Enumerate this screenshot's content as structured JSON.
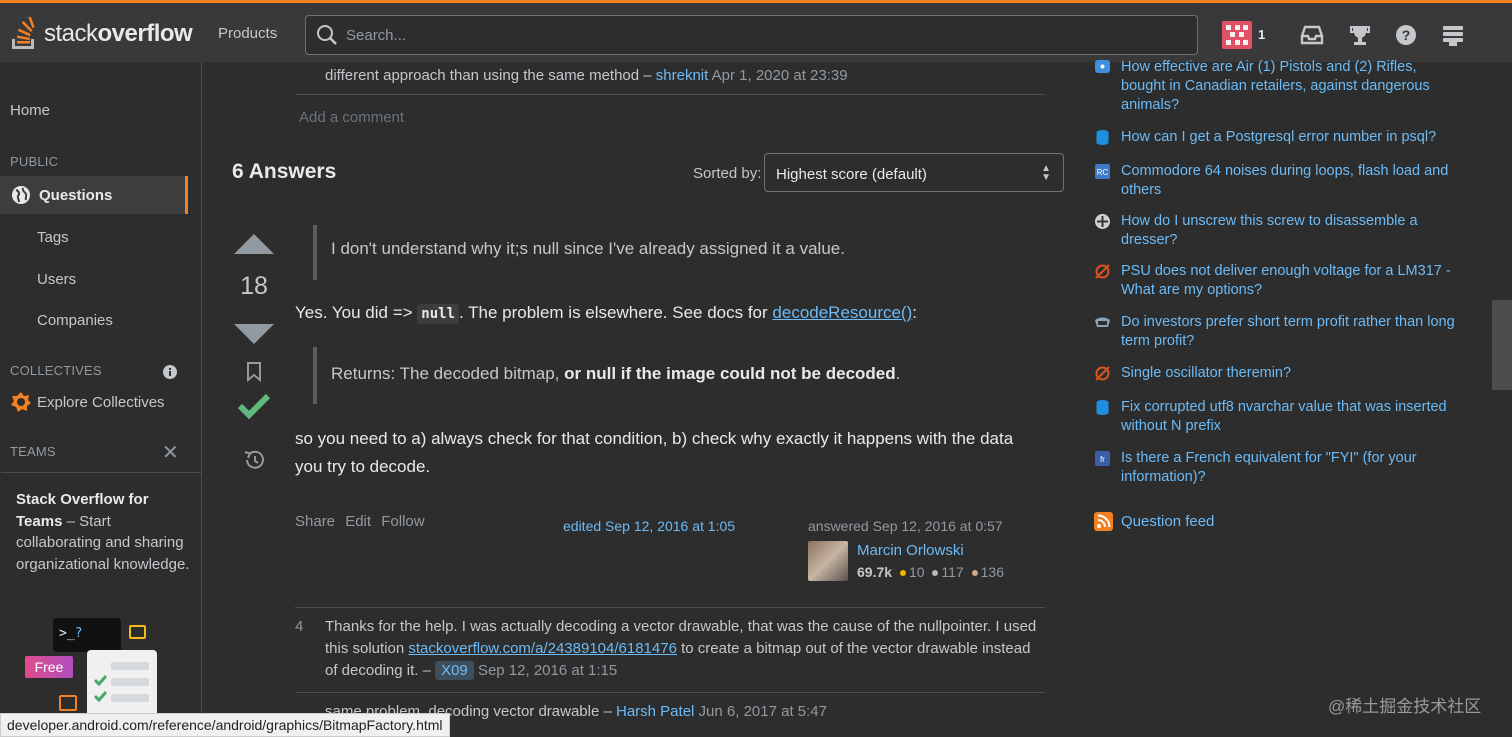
{
  "topbar": {
    "logo_light": "stack",
    "logo_bold": "overflow",
    "products_label": "Products",
    "search_placeholder": "Search...",
    "reputation": "1"
  },
  "sidebar": {
    "home": "Home",
    "public_heading": "PUBLIC",
    "questions": "Questions",
    "tags": "Tags",
    "users": "Users",
    "companies": "Companies",
    "collectives_heading": "COLLECTIVES",
    "explore_collectives": "Explore Collectives",
    "teams_heading": "TEAMS",
    "teams_title": "Stack Overflow for Teams",
    "teams_desc": " – Start collaborating and sharing organizational knowledge.",
    "terminal_text": ">_",
    "terminal_q": "?",
    "free_label": "Free"
  },
  "main": {
    "prev_comment_text": "different approach than using the same method – ",
    "prev_comment_user": "shreknit",
    "prev_comment_date": "Apr 1, 2020 at 23:39",
    "add_comment": "Add a comment",
    "answers_heading": "6 Answers",
    "sorted_by_label": "Sorted by:",
    "sort_selected": "Highest score (default)",
    "answer": {
      "score": "18",
      "quote1": "I don't understand why it;s null since I've already assigned it a value.",
      "p1_before": "Yes. You did => ",
      "p1_code": "null",
      "p1_middle": ". The problem is elsewhere. See docs for ",
      "p1_link": "decodeResource()",
      "p1_after": ":",
      "quote2_before": "Returns: The decoded bitmap, ",
      "quote2_bold": "or null if the image could not be decoded",
      "quote2_after": ".",
      "p2": "so you need to a) always check for that condition, b) check why exactly it happens with the data you try to decode.",
      "share": "Share",
      "edit": "Edit",
      "follow": "Follow",
      "edited": "edited Sep 12, 2016 at 1:05",
      "answered": "answered Sep 12, 2016 at 0:57",
      "user_name": "Marcin Orlowski",
      "user_rep": "69.7k",
      "gold": "10",
      "silver": "117",
      "bronze": "136"
    },
    "comments": [
      {
        "score": "4",
        "text_before": "Thanks for the help. I was actually decoding a vector drawable, that was the cause of the nullpointer. I used this solution ",
        "link": "stackoverflow.com/a/24389104/6181476",
        "text_after": " to create a bitmap out of the vector drawable instead of decoding it. – ",
        "user": "X09",
        "date": "Sep 12, 2016 at 1:15"
      },
      {
        "score": "",
        "text_before": "same problem, decoding vector drawable – ",
        "user": "Harsh Patel",
        "date": "Jun 6, 2017 at 5:47"
      }
    ]
  },
  "hot_network_questions": [
    {
      "title": "How effective are Air (1) Pistols and (2) Rifles, bought in Canadian retailers, against dangerous animals?",
      "icon": "blue-chat-icon",
      "color": "#3d8fe0"
    },
    {
      "title": "How can I get a Postgresql error number in psql?",
      "icon": "database-icon",
      "color": "#1e8fe0"
    },
    {
      "title": "Commodore 64 noises during loops, flash load and others",
      "icon": "retrocomputing-icon",
      "color": "#3b7bc8"
    },
    {
      "title": "How do I unscrew this screw to disassemble a dresser?",
      "icon": "diy-icon",
      "color": "#d0d0d0"
    },
    {
      "title": "PSU does not deliver enough voltage for a LM317 - What are my options?",
      "icon": "electronics-icon",
      "color": "#d9531e"
    },
    {
      "title": "Do investors prefer short term profit rather than long term profit?",
      "icon": "money-icon",
      "color": "#8aa4b8"
    },
    {
      "title": "Single oscillator theremin?",
      "icon": "electronics-icon",
      "color": "#d9531e"
    },
    {
      "title": "Fix corrupted utf8 nvarchar value that was inserted without N prefix",
      "icon": "database-icon",
      "color": "#1e8fe0"
    },
    {
      "title": "Is there a French equivalent for \"FYI\" (for your information)?",
      "icon": "french-icon",
      "color": "#3a5fa8"
    }
  ],
  "question_feed": "Question feed",
  "status_bar": "developer.android.com/reference/android/graphics/BitmapFactory.html",
  "watermark": "@稀土掘金技术社区"
}
